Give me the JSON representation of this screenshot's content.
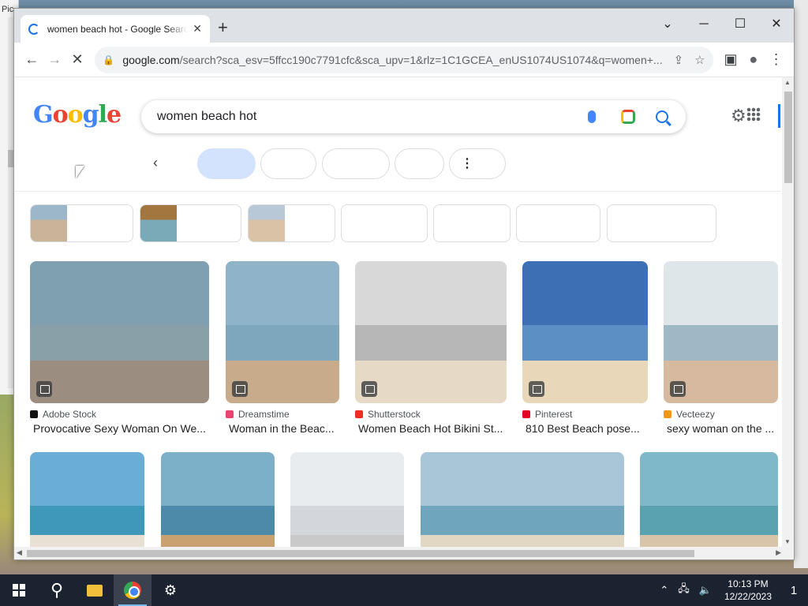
{
  "desktop": {
    "left_title": "Pic"
  },
  "tab": {
    "title": "women beach hot - Google Search",
    "close": "✕",
    "new": "+"
  },
  "window_controls": {
    "dropdown": "⌄",
    "minimize": "─",
    "maximize": "☐",
    "close": "✕"
  },
  "toolbar": {
    "back": "←",
    "forward": "→",
    "reload": "✕",
    "url_domain": "google.com",
    "url_rest": "/search?sca_esv=5ffcc190c7791cfc&sca_upv=1&rlz=1C1GCEA_enUS1074US1074&q=women+...",
    "share": "⇪",
    "star": "☆",
    "sidepanel": "▣",
    "profile": "●",
    "menu": "⋮"
  },
  "google": {
    "logo": [
      "G",
      "o",
      "o",
      "g",
      "l",
      "e"
    ],
    "query": "women beach hot",
    "settings": "⚙",
    "chev_left": "‹",
    "more_chip": "⋮"
  },
  "results_row1": [
    {
      "source": "Adobe Stock",
      "title": "Provocative Sexy Woman On We...",
      "icon_color": "#111111",
      "palette": [
        "#7fa0b0",
        "#8aa0a8",
        "#9b8e80"
      ]
    },
    {
      "source": "Dreamstime",
      "title": "Woman in the Beac...",
      "icon_color": "#e9436f",
      "palette": [
        "#8fb3c9",
        "#7ea6bd",
        "#c8ab8b"
      ]
    },
    {
      "source": "Shutterstock",
      "title": "Women Beach Hot Bikini St...",
      "icon_color": "#ee2e24",
      "palette": [
        "#d8d8d8",
        "#b7b7b7",
        "#e6d9c5"
      ]
    },
    {
      "source": "Pinterest",
      "title": "810 Best Beach pose...",
      "icon_color": "#e60023",
      "palette": [
        "#3d6fb4",
        "#5c8fc4",
        "#e8d7b8"
      ]
    },
    {
      "source": "Vecteezy",
      "title": "sexy woman on the ...",
      "icon_color": "#f0961c",
      "palette": [
        "#dfe6ea",
        "#9fb8c5",
        "#d7b9a0"
      ]
    }
  ],
  "results_row2": [
    {
      "palette": [
        "#6aaed6",
        "#3f98b8",
        "#e7e0d3"
      ]
    },
    {
      "palette": [
        "#7bb0c8",
        "#4d89a8",
        "#c9a06f"
      ]
    },
    {
      "palette": [
        "#e9ecef",
        "#d3d6da",
        "#c9c9c9"
      ]
    },
    {
      "palette": [
        "#a9c5d8",
        "#6fa6bd",
        "#e2d7c3"
      ]
    },
    {
      "palette": [
        "#7fb9c9",
        "#5aa2b0",
        "#d8c4a8"
      ]
    }
  ],
  "taskbar": {
    "search": "⚲",
    "settings": "⚙",
    "time": "10:13 PM",
    "date": "12/22/2023",
    "notifications": "1",
    "tray_up": "⌃",
    "network": "🖧",
    "volume": "🔈"
  }
}
